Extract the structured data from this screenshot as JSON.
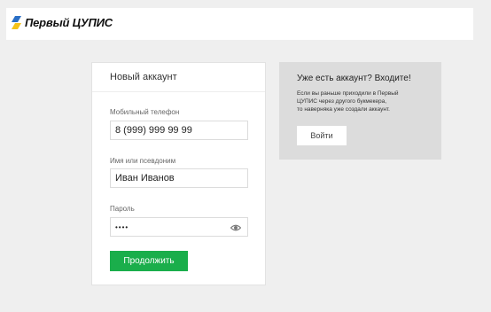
{
  "brand": {
    "name": "Первый ЦУПИС"
  },
  "register": {
    "title": "Новый аккаунт",
    "phone": {
      "label": "Мобильный телефон",
      "value": "8 (999) 999 99 99"
    },
    "name": {
      "label": "Имя или псевдоним",
      "value": "Иван Иванов"
    },
    "password": {
      "label": "Пароль",
      "value": "••••"
    },
    "continue_label": "Продолжить"
  },
  "login_panel": {
    "title": "Уже есть аккаунт? Входите!",
    "text": "Если вы раньше приходили в Первый\nЦУПИС через другого букмекера,\nто наверняка уже создали аккаунт.",
    "login_label": "Войти"
  },
  "colors": {
    "accent_green": "#1aae4b",
    "logo_blue": "#2a6fc6",
    "logo_yellow": "#f4c21a"
  },
  "icons": [
    "logo-mark-icon",
    "eye-icon"
  ]
}
